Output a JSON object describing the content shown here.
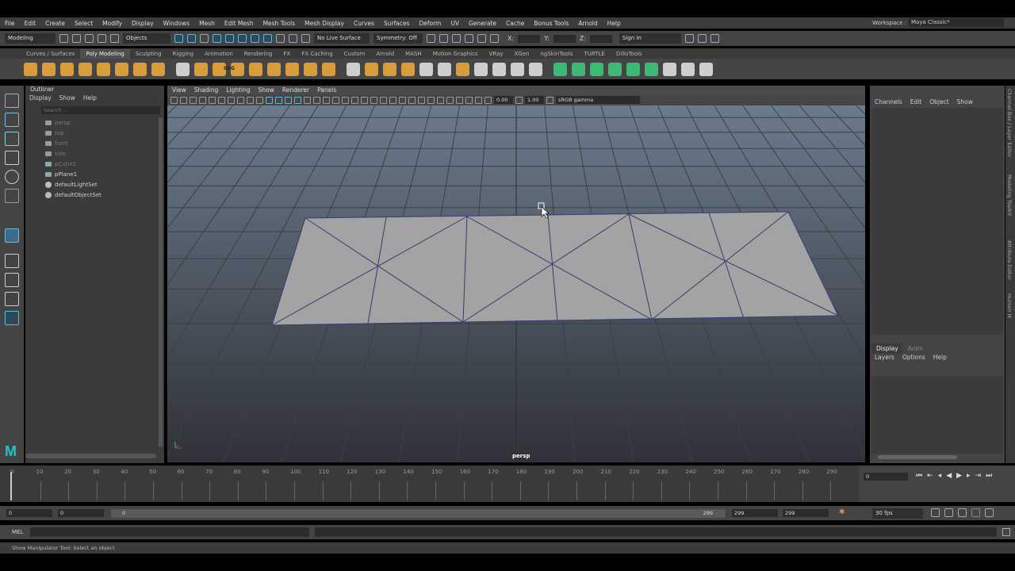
{
  "menubar": {
    "items": [
      "File",
      "Edit",
      "Create",
      "Select",
      "Modify",
      "Display",
      "Windows",
      "Mesh",
      "Edit Mesh",
      "Mesh Tools",
      "Mesh Display",
      "Curves",
      "Surfaces",
      "Deform",
      "UV",
      "Generate",
      "Cache",
      "Bonus Tools",
      "Arnold",
      "Help"
    ],
    "workspace_label": "Workspace :",
    "workspace_value": "Maya Classic*"
  },
  "statusline": {
    "mode": "Modeling",
    "selection_mode": "Objects",
    "live_surface": "No Live Surface",
    "symmetry": "Symmetry: Off",
    "x_label": "X:",
    "y_label": "Y:",
    "z_label": "Z:",
    "sign_in": "Sign In"
  },
  "shelf": {
    "tabs": [
      "Curves / Surfaces",
      "Poly Modeling",
      "Sculpting",
      "Rigging",
      "Animation",
      "Rendering",
      "FX",
      "FX Caching",
      "Custom",
      "Arnold",
      "MASH",
      "Motion Graphics",
      "VRay",
      "XGen",
      "ngSkinTools",
      "TURTLE",
      "DilloTools"
    ],
    "active_tab": "Poly Modeling",
    "svg_label": "SVG",
    "icon_colors": [
      "#e8a53a",
      "#e8a53a",
      "#e8a53a",
      "#e8a53a",
      "#e8a53a",
      "#e8a53a",
      "#e8a53a",
      "#e8a53a",
      "#ddd",
      "#e8a53a",
      "#e8a53a",
      "#e8a53a",
      "#e8a53a",
      "#e8a53a",
      "#e8a53a",
      "#e8a53a",
      "#e8a53a",
      "#ddd",
      "#e8a53a",
      "#e8a53a",
      "#e8a53a",
      "#ddd",
      "#ddd",
      "#e8a53a",
      "#ddd",
      "#ddd",
      "#ddd",
      "#ddd",
      "#3cc47a",
      "#3cc47a",
      "#3cc47a",
      "#3cc47a",
      "#3cc47a",
      "#3cc47a",
      "#ddd",
      "#ddd",
      "#ddd"
    ]
  },
  "outliner": {
    "title": "Outliner",
    "menu": [
      "Display",
      "Show",
      "Help"
    ],
    "search_placeholder": "Search...",
    "items": [
      {
        "label": "persp",
        "icon": "camera-icon",
        "dim": true
      },
      {
        "label": "top",
        "icon": "camera-icon",
        "dim": true
      },
      {
        "label": "front",
        "icon": "camera-icon",
        "dim": true
      },
      {
        "label": "side",
        "icon": "camera-icon",
        "dim": true
      },
      {
        "label": "pCube2",
        "icon": "mesh-icon",
        "dim": true
      },
      {
        "label": "pPlane1",
        "icon": "mesh-icon",
        "dim": false
      },
      {
        "label": "defaultLightSet",
        "icon": "set-icon",
        "dim": false
      },
      {
        "label": "defaultObjectSet",
        "icon": "set-icon",
        "dim": false
      }
    ]
  },
  "viewport": {
    "menu": [
      "View",
      "Shading",
      "Lighting",
      "Show",
      "Renderer",
      "Panels"
    ],
    "exposure": "0.00",
    "gamma": "1.00",
    "color_space": "sRGB gamma",
    "camera_label": "persp",
    "bg_top": "#6b7b8c",
    "bg_bottom": "#2f3237"
  },
  "channelbox": {
    "menu": [
      "Channels",
      "Edit",
      "Object",
      "Show"
    ],
    "layer_tabs": [
      "Display",
      "Anim"
    ],
    "layer_menu": [
      "Layers",
      "Options",
      "Help"
    ]
  },
  "side_tabs": [
    "Channel Box / Layer Editor",
    "Modeling Toolkit",
    "Attribute Editor",
    "Human IK"
  ],
  "timeline": {
    "ticks": [
      "10",
      "20",
      "30",
      "40",
      "50",
      "60",
      "70",
      "80",
      "90",
      "100",
      "110",
      "120",
      "130",
      "140",
      "150",
      "160",
      "170",
      "180",
      "190",
      "200",
      "210",
      "220",
      "230",
      "240",
      "250",
      "260",
      "270",
      "280",
      "290"
    ],
    "start_label": "0",
    "current_frame": "0"
  },
  "range": {
    "start": "0",
    "playback_start": "0",
    "slider_start": "0",
    "slider_end": "299",
    "end": "299",
    "anim_end": "299",
    "fps": "30 fps"
  },
  "mel": {
    "label": "MEL"
  },
  "helpline": {
    "text": "Show Manipulator Tool: Select an object"
  }
}
